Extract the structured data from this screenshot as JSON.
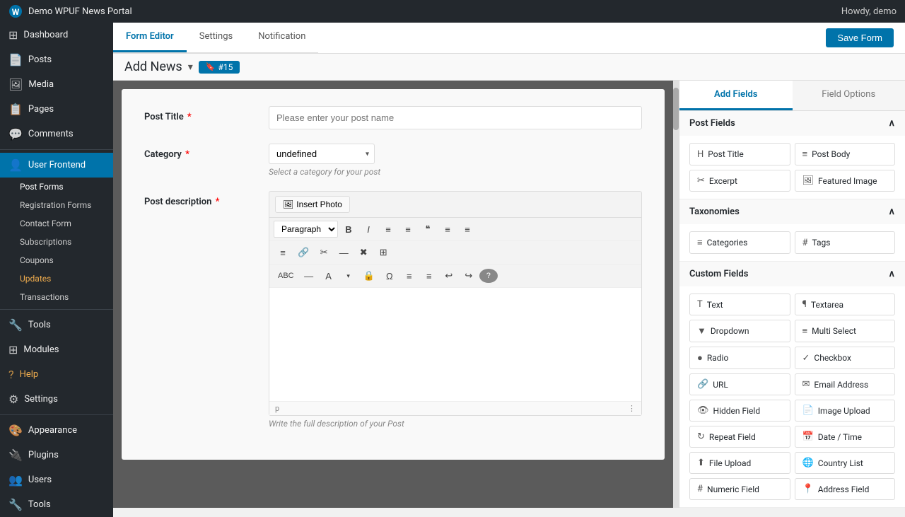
{
  "admin_bar": {
    "site_name": "Demo WPUF News Portal",
    "howdy": "Howdy, demo"
  },
  "sidebar": {
    "items": [
      {
        "id": "dashboard",
        "label": "Dashboard",
        "icon": "⊞"
      },
      {
        "id": "posts",
        "label": "Posts",
        "icon": "📄"
      },
      {
        "id": "media",
        "label": "Media",
        "icon": "🖼"
      },
      {
        "id": "pages",
        "label": "Pages",
        "icon": "📋"
      },
      {
        "id": "comments",
        "label": "Comments",
        "icon": "💬"
      },
      {
        "id": "user-frontend",
        "label": "User Frontend",
        "icon": "👤",
        "active": true
      },
      {
        "id": "post-forms",
        "label": "Post Forms",
        "icon": "",
        "sub": true
      },
      {
        "id": "registration-forms",
        "label": "Registration Forms",
        "sub": true
      },
      {
        "id": "contact-form",
        "label": "Contact Form",
        "sub": true
      },
      {
        "id": "subscriptions",
        "label": "Subscriptions",
        "sub": true
      },
      {
        "id": "coupons",
        "label": "Coupons",
        "sub": true
      },
      {
        "id": "updates",
        "label": "Updates",
        "sub": true
      },
      {
        "id": "transactions",
        "label": "Transactions",
        "sub": true
      },
      {
        "id": "tools",
        "label": "Tools",
        "icon": "🔧"
      },
      {
        "id": "modules",
        "label": "Modules",
        "icon": ""
      },
      {
        "id": "help",
        "label": "Help",
        "icon": ""
      },
      {
        "id": "settings",
        "label": "Settings",
        "icon": ""
      },
      {
        "id": "appearance",
        "label": "Appearance",
        "icon": "🎨"
      },
      {
        "id": "plugins",
        "label": "Plugins",
        "icon": "🔌"
      },
      {
        "id": "users",
        "label": "Users",
        "icon": "👥"
      },
      {
        "id": "tools2",
        "label": "Tools",
        "icon": "🔧"
      }
    ]
  },
  "tabs": [
    {
      "id": "form-editor",
      "label": "Form Editor",
      "active": true
    },
    {
      "id": "settings",
      "label": "Settings"
    },
    {
      "id": "notification",
      "label": "Notification"
    }
  ],
  "form_header": {
    "title": "Add News",
    "form_id": "#15",
    "save_label": "Save Form"
  },
  "form_fields": [
    {
      "label": "Post Title",
      "required": true,
      "type": "text",
      "placeholder": "Please enter your post name"
    },
    {
      "label": "Category",
      "required": true,
      "type": "select",
      "value": "undefined",
      "hint": "Select a category for your post"
    },
    {
      "label": "Post description",
      "required": true,
      "type": "editor"
    }
  ],
  "editor": {
    "insert_photo_label": "Insert Photo",
    "paragraph_select": "Paragraph",
    "toolbar_buttons": [
      "B",
      "I",
      "≡",
      "≡",
      "❝",
      "≡",
      "≡"
    ],
    "toolbar2": [
      "≡",
      "🔗",
      "✂",
      "—",
      "≡",
      "✖",
      "⊞"
    ],
    "toolbar3": [
      "ABC",
      "—",
      "A",
      "🔒",
      "Ω",
      "≡",
      "≡",
      "↩",
      "↪"
    ],
    "status_char": "p",
    "hint": "Write the full description of your Post"
  },
  "right_panel": {
    "tabs": [
      {
        "id": "add-fields",
        "label": "Add Fields",
        "active": true
      },
      {
        "id": "field-options",
        "label": "Field Options"
      }
    ],
    "sections": [
      {
        "id": "post-fields",
        "label": "Post Fields",
        "fields": [
          {
            "icon": "H",
            "label": "Post Title"
          },
          {
            "icon": "≡",
            "label": "Post Body"
          },
          {
            "icon": "✂",
            "label": "Excerpt"
          },
          {
            "icon": "🖼",
            "label": "Featured Image"
          }
        ]
      },
      {
        "id": "taxonomies",
        "label": "Taxonomies",
        "fields": [
          {
            "icon": "≡",
            "label": "Categories"
          },
          {
            "icon": "#",
            "label": "Tags"
          }
        ]
      },
      {
        "id": "custom-fields",
        "label": "Custom Fields",
        "fields": [
          {
            "icon": "T",
            "label": "Text"
          },
          {
            "icon": "¶",
            "label": "Textarea"
          },
          {
            "icon": "▼",
            "label": "Dropdown"
          },
          {
            "icon": "≡",
            "label": "Multi Select"
          },
          {
            "icon": "●",
            "label": "Radio"
          },
          {
            "icon": "✓",
            "label": "Checkbox"
          },
          {
            "icon": "🔗",
            "label": "URL"
          },
          {
            "icon": "✉",
            "label": "Email Address"
          },
          {
            "icon": "👁",
            "label": "Hidden Field"
          },
          {
            "icon": "📄",
            "label": "Image Upload"
          },
          {
            "icon": "↻",
            "label": "Repeat Field"
          },
          {
            "icon": "📅",
            "label": "Date / Time"
          },
          {
            "icon": "⬆",
            "label": "File Upload"
          },
          {
            "icon": "🌐",
            "label": "Country List"
          },
          {
            "icon": "#",
            "label": "Numeric Field"
          },
          {
            "icon": "📍",
            "label": "Address Field"
          }
        ]
      }
    ]
  }
}
